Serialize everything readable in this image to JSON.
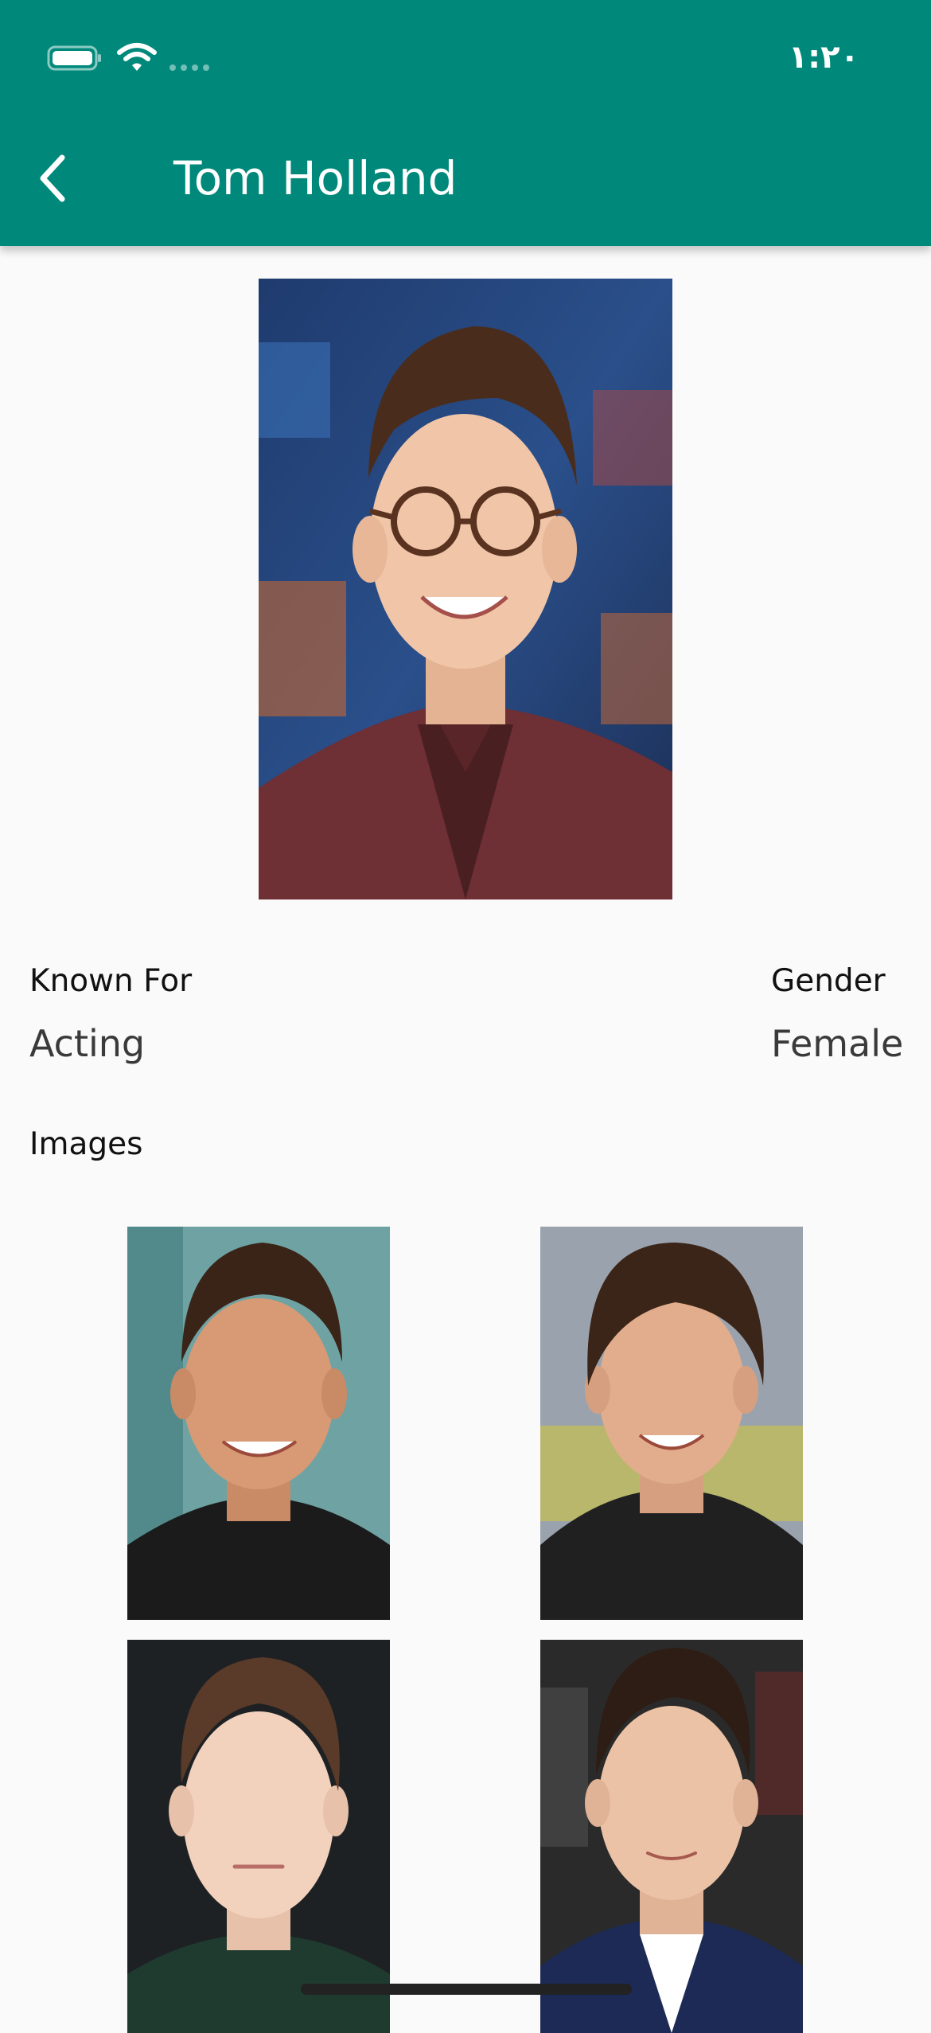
{
  "status_bar": {
    "time": "١:٢٠",
    "battery_icon": "battery-icon",
    "wifi_icon": "wifi-icon"
  },
  "app_bar": {
    "title": "Tom Holland",
    "back_icon": "chevron-left-icon",
    "background_color": "#00897b"
  },
  "profile": {
    "photo_icon": "portrait-photo"
  },
  "details": {
    "known_for_label": "Known For",
    "known_for_value": "Acting",
    "gender_label": "Gender",
    "gender_value": "Female"
  },
  "images_section": {
    "heading": "Images",
    "images": [
      {
        "icon": "photo-thumbnail"
      },
      {
        "icon": "photo-thumbnail"
      },
      {
        "icon": "photo-thumbnail"
      },
      {
        "icon": "photo-thumbnail"
      }
    ]
  }
}
